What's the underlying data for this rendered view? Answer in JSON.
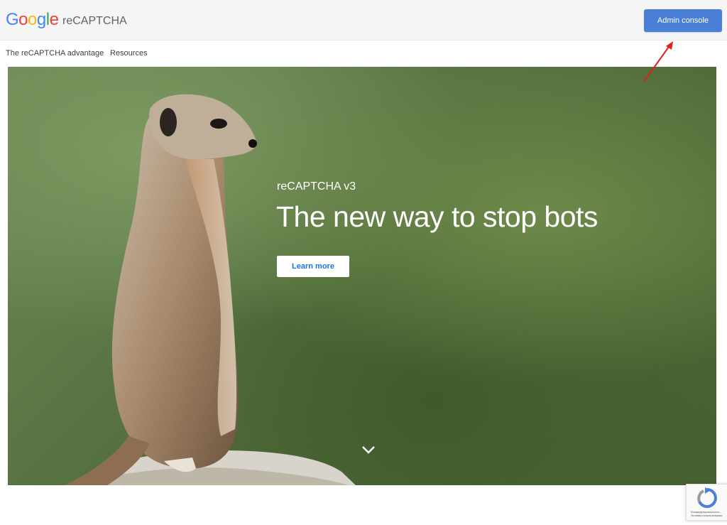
{
  "header": {
    "logo_letters": [
      {
        "ch": "G",
        "color": "#4285F4"
      },
      {
        "ch": "o",
        "color": "#EA4335"
      },
      {
        "ch": "o",
        "color": "#FBBC05"
      },
      {
        "ch": "g",
        "color": "#4285F4"
      },
      {
        "ch": "l",
        "color": "#34A853"
      },
      {
        "ch": "e",
        "color": "#EA4335"
      }
    ],
    "product": "reCAPTCHA",
    "admin_button": "Admin console"
  },
  "nav": {
    "items": [
      {
        "label": "The reCAPTCHA advantage"
      },
      {
        "label": "Resources"
      }
    ]
  },
  "hero": {
    "subtitle": "reCAPTCHA v3",
    "title": "The new way to stop bots",
    "learn_more": "Learn more"
  },
  "badge": {
    "text": "Конфиденциальность - Условия использования"
  },
  "colors": {
    "accent": "#4a7fd8",
    "link": "#1a73e8",
    "annotation": "#e0201c"
  },
  "icons": {
    "scroll": "chevron-down-icon",
    "badge": "recaptcha-icon"
  }
}
